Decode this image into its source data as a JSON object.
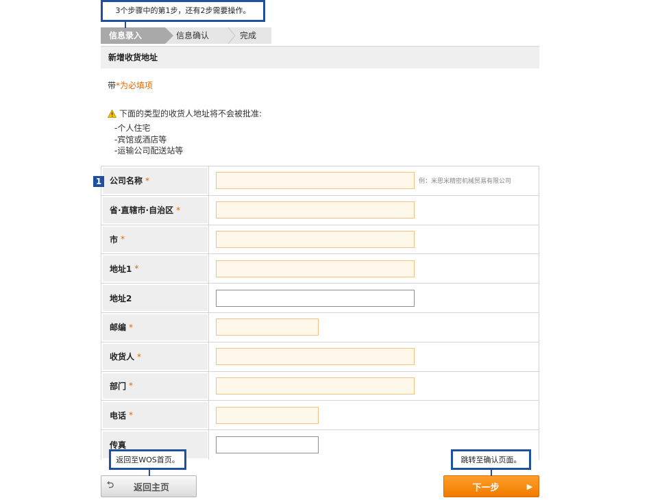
{
  "callouts": {
    "top": "3个步骤中的第1步，还有2步需要操作。",
    "back": "返回至WOS首页。",
    "next": "跳转至确认页面。"
  },
  "steps": [
    "信息录入",
    "信息确认",
    "完成"
  ],
  "section_title": "新增收货地址",
  "required_note": {
    "prefix": "带",
    "mark": "*为必填项"
  },
  "warning": {
    "icon": "warning-icon",
    "text": "下面的类型的收货人地址将不会被批准:",
    "items": [
      "-个人住宅",
      "-宾馆或酒店等",
      "-运输公司配送站等"
    ]
  },
  "badge": "1",
  "form": [
    {
      "label": "公司名称",
      "required": "*",
      "hint": "例：米思米精密机械贸易有限公司"
    },
    {
      "label": "省·直辖市·自治区",
      "required": "*"
    },
    {
      "label": "市",
      "required": "*"
    },
    {
      "label": "地址1",
      "required": "*"
    },
    {
      "label": "地址2",
      "required": ""
    },
    {
      "label": "邮编",
      "required": "*"
    },
    {
      "label": "收货人",
      "required": "*"
    },
    {
      "label": "部门",
      "required": "*"
    },
    {
      "label": "电话",
      "required": "*"
    },
    {
      "label": "传真",
      "required": ""
    }
  ],
  "buttons": {
    "back": "返回主页",
    "next": "下一步"
  },
  "colors": {
    "accent": "#1f4f9f",
    "required": "#e06a00",
    "next_button": "#f07a00"
  }
}
